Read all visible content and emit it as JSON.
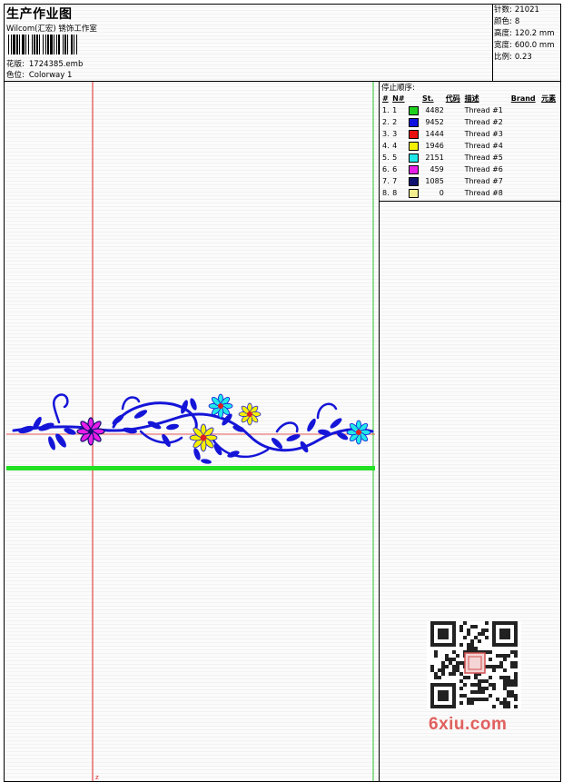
{
  "header": {
    "title": "生产作业图",
    "company": "Wilcom(汇宏) 锈饰工作室",
    "design_label": "花版:",
    "design_value": "1724385.emb",
    "colorway_label": "色位:",
    "colorway_value": "Colorway 1"
  },
  "meta": [
    {
      "label": "针数:",
      "value": "21021"
    },
    {
      "label": "颜色:",
      "value": "8"
    },
    {
      "label": "高度:",
      "value": "120.2 mm"
    },
    {
      "label": "宽度:",
      "value": "600.0 mm"
    },
    {
      "label": "比例:",
      "value": "0.23"
    }
  ],
  "stop_sequence": {
    "title": "停止顺序:",
    "columns": [
      "#",
      "N#",
      "St.",
      "代码",
      "描述",
      "Brand",
      "元素"
    ],
    "rows": [
      {
        "idx": "1.",
        "n": "1",
        "color": "#1fd11f",
        "st": "4482",
        "desc": "Thread #1"
      },
      {
        "idx": "2.",
        "n": "2",
        "color": "#1010e0",
        "st": "9452",
        "desc": "Thread #2"
      },
      {
        "idx": "3.",
        "n": "3",
        "color": "#e81010",
        "st": "1444",
        "desc": "Thread #3"
      },
      {
        "idx": "4.",
        "n": "4",
        "color": "#f5f000",
        "st": "1946",
        "desc": "Thread #4"
      },
      {
        "idx": "5.",
        "n": "5",
        "color": "#20e8e8",
        "st": "2151",
        "desc": "Thread #5"
      },
      {
        "idx": "6.",
        "n": "6",
        "color": "#e81ee8",
        "st": "459",
        "desc": "Thread #6"
      },
      {
        "idx": "7.",
        "n": "7",
        "color": "#101070",
        "st": "1085",
        "desc": "Thread #7"
      },
      {
        "idx": "8.",
        "n": "8",
        "color": "#f2ee90",
        "st": "0",
        "desc": "Thread #8"
      }
    ]
  },
  "colors": {
    "guide_red": "#e02020",
    "guide_green": "#2ec42e",
    "vine_blue": "#1515d8",
    "bar_green": "#22e022",
    "watermark": "#e0605e"
  },
  "canvas": {
    "origin_marker": "z"
  },
  "watermark": "6xiu.com"
}
